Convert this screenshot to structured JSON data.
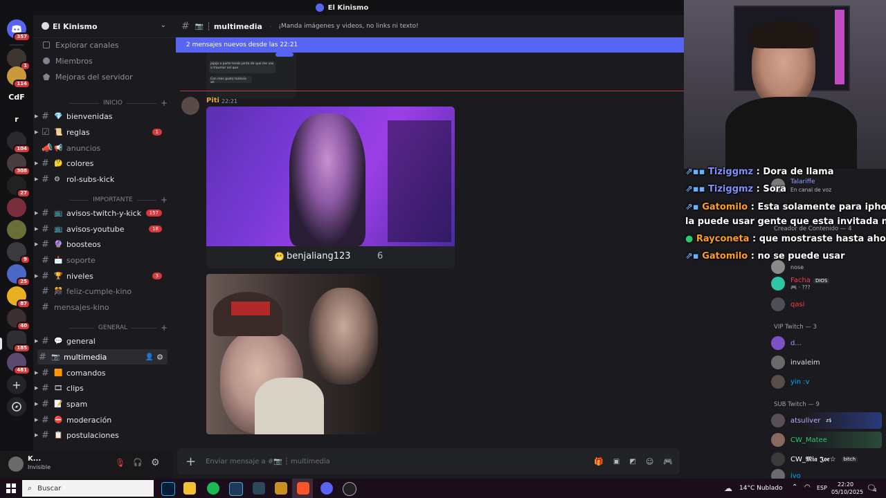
{
  "window": {
    "title": "El Kinismo"
  },
  "rail": {
    "badges": [
      "357",
      "1",
      "114",
      "104",
      "308",
      "27",
      "9",
      "25",
      "87",
      "40",
      "185",
      "481"
    ],
    "text_servers": [
      "CdF",
      "r"
    ]
  },
  "sidebar": {
    "server_name": "El Kinismo",
    "nav": [
      "Explorar canales",
      "Miembros",
      "Mejoras del servidor"
    ],
    "categories": {
      "inicio": "INICIO",
      "importante": "IMPORTANTE",
      "general": "GENERAL"
    },
    "channels": [
      {
        "emoji": "💎",
        "label": "bienvenidas",
        "badge": ""
      },
      {
        "emoji": "📜",
        "label": "reglas",
        "badge": "1"
      },
      {
        "emoji": "📢",
        "label": "anuncios",
        "badge": ""
      },
      {
        "emoji": "🤔",
        "label": "colores",
        "badge": ""
      },
      {
        "emoji": "⚙",
        "label": "rol-subs-kick",
        "badge": ""
      },
      {
        "emoji": "📺",
        "label": "avisos-twitch-y-kick",
        "badge": "157"
      },
      {
        "emoji": "📺",
        "label": "avisos-youtube",
        "badge": "18"
      },
      {
        "emoji": "🔮",
        "label": "boosteos",
        "badge": ""
      },
      {
        "emoji": "📩",
        "label": "soporte",
        "badge": ""
      },
      {
        "emoji": "🏆",
        "label": "niveles",
        "badge": "3"
      },
      {
        "emoji": "🎊",
        "label": "feliz-cumple-kino",
        "badge": ""
      },
      {
        "emoji": "",
        "label": "mensajes-kino",
        "badge": ""
      },
      {
        "emoji": "💬",
        "label": "general",
        "badge": ""
      },
      {
        "emoji": "📷",
        "label": "multimedia",
        "badge": ""
      },
      {
        "emoji": "🟧",
        "label": "comandos",
        "badge": ""
      },
      {
        "emoji": "🎞",
        "label": "clips",
        "badge": ""
      },
      {
        "emoji": "📝",
        "label": "spam",
        "badge": ""
      },
      {
        "emoji": "⛔",
        "label": "moderación",
        "badge": ""
      },
      {
        "emoji": "📋",
        "label": "postulaciones",
        "badge": ""
      }
    ]
  },
  "user": {
    "name": "K...",
    "status": "Invisible"
  },
  "chat": {
    "channel": "multimedia",
    "topic": "¡Manda imágenes y videos, no links ni texto!",
    "new_banner": "2 mensajes nuevos desde las 22:21",
    "message": {
      "author": "Piti",
      "time": "22:21"
    },
    "embed": {
      "username": "benjaliang123",
      "count": "6"
    },
    "input_placeholder": "Enviar mensaje a #📷 ┆ multimedia",
    "preview_lines": [
      "jajaja a parte tenés pinta de que me vas a traumar así que",
      "Con mas gusto todavia ah"
    ]
  },
  "twitch_chat": [
    {
      "user": "Tiziggmz",
      "msg": "Dora de llama",
      "color": "#7f8fff"
    },
    {
      "user": "Tiziggmz",
      "msg": "Sora",
      "color": "#7f8fff"
    },
    {
      "user": "Gatomilo",
      "msg": "Esta solamente para iphone y",
      "cont": "la puede usar gente que esta invitada nomas",
      "color": "#ff9f1a"
    },
    {
      "user": "Rayconeta",
      "msg": "que mostraste hasta ahor?",
      "color": "#ff9f1a"
    },
    {
      "user": "Gatomilo",
      "msg": "no se puede usar",
      "color": "#ff9f1a"
    }
  ],
  "members": {
    "partial_top": [
      "Talariffe",
      "En canal de voz"
    ],
    "section_creator": "Creador de Contenido — 4",
    "creators": [
      {
        "name": "nose",
        "sub": "",
        "color": "#b5bac1"
      },
      {
        "name": "Facha",
        "sub": "🎮 · ???",
        "color": "#f23f43",
        "tag": "DIOS"
      },
      {
        "name": "qasi",
        "sub": "",
        "color": "#f23f43"
      }
    ],
    "section_vip": "VIP Twitch — 3",
    "vips": [
      {
        "name": "d...",
        "color": "#8ea1ff"
      },
      {
        "name": "invaleim",
        "color": "#dbdee1"
      },
      {
        "name": "yin :v",
        "color": "#00a8fc"
      }
    ],
    "section_sub": "SUB Twitch — 9",
    "subs": [
      {
        "name": "atsuliver",
        "color": "#c9a6ff",
        "tag": "z$"
      },
      {
        "name": "CW_Matee",
        "color": "#2dc770"
      },
      {
        "name": "CW_𝕸𝖎𝖆 𝕵𝖔𝖊☆",
        "color": "#ffffff",
        "tag": "bitch"
      },
      {
        "name": "ivo",
        "color": "#00a8fc"
      }
    ]
  },
  "taskbar": {
    "search_placeholder": "Buscar",
    "weather": "14°C  Nublado",
    "lang": "ESP",
    "time": "22:20",
    "date": "05/10/2025",
    "notif": "4"
  }
}
